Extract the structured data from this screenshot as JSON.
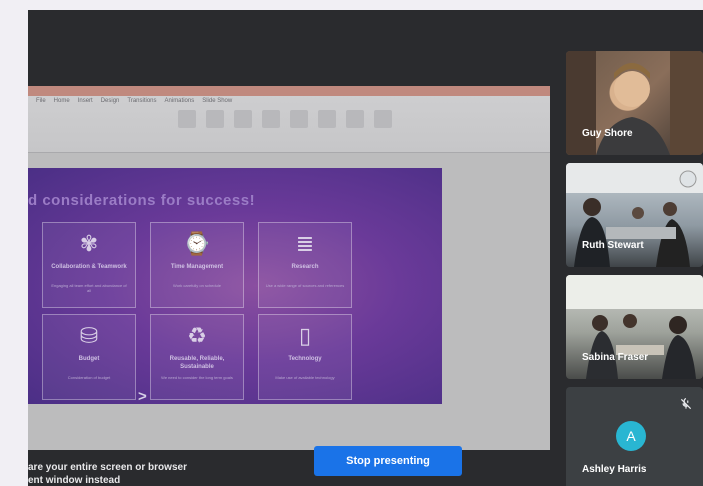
{
  "presentation": {
    "ribbon_tabs": [
      "File",
      "Home",
      "Insert",
      "Design",
      "Transitions",
      "Animations",
      "Slide Show"
    ],
    "slide": {
      "title": "d considerations for success!",
      "tiles": [
        {
          "icon": "handshake-icon",
          "glyph": "✾",
          "title": "Collaboration & Teamwork",
          "desc": "Engaging all team effort and abundance of all"
        },
        {
          "icon": "clock-icon",
          "glyph": "⌚",
          "title": "Time Management",
          "desc": "Work carefully on schedule"
        },
        {
          "icon": "books-icon",
          "glyph": "≣",
          "title": "Research",
          "desc": "Use a wide range of sources and references"
        },
        {
          "icon": "coins-icon",
          "glyph": "⛁",
          "title": "Budget",
          "desc": "Consideration of budget"
        },
        {
          "icon": "recycle-icon",
          "glyph": "♻",
          "title": "Reusable, Reliable, Sustainable",
          "desc": "We need to consider the long term goals"
        },
        {
          "icon": "tablet-icon",
          "glyph": "▯",
          "title": "Technology",
          "desc": "Make use of available technology"
        }
      ],
      "arrow": ">"
    }
  },
  "share_message": {
    "line1": "are your entire screen or browser",
    "line2": "ent window instead"
  },
  "stop_presenting": "Stop presenting",
  "participants": [
    {
      "name": "Guy Shore",
      "type": "video"
    },
    {
      "name": "Ruth Stewart",
      "type": "video"
    },
    {
      "name": "Sabina Fraser",
      "type": "video"
    },
    {
      "name": "Ashley Harris",
      "type": "avatar",
      "initial": "A",
      "avatar_color": "#29b6d2",
      "muted": true
    }
  ]
}
